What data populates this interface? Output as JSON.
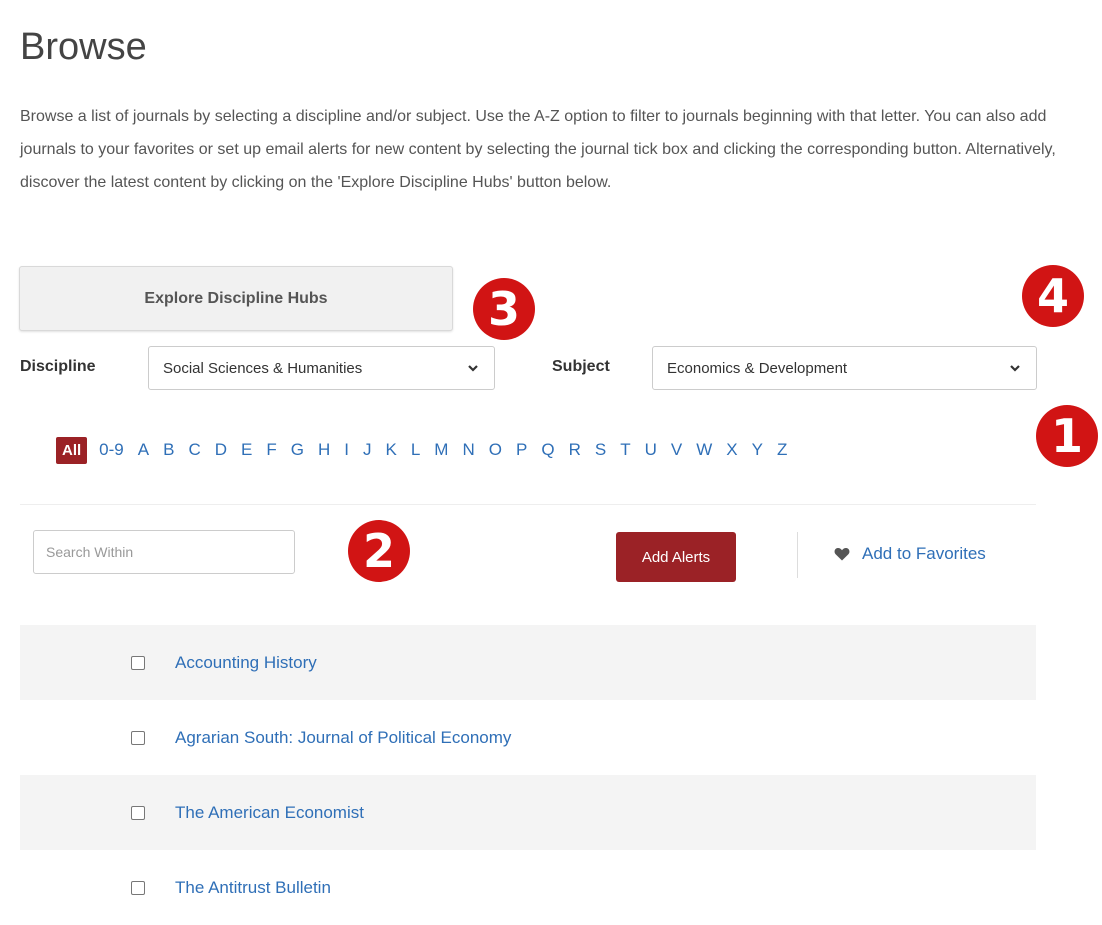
{
  "page": {
    "title": "Browse",
    "intro": "Browse a list of journals by selecting a discipline and/or subject. Use the A-Z option to filter to journals beginning with that letter. You can also add journals to your favorites or set up email alerts for new content by selecting the journal tick box and clicking the corresponding button. Alternatively, discover the latest content by clicking on the 'Explore Discipline Hubs' button below."
  },
  "hubs_button": {
    "label": "Explore Discipline Hubs"
  },
  "filters": {
    "discipline_label": "Discipline",
    "discipline_value": "Social Sciences & Humanities",
    "subject_label": "Subject",
    "subject_value": "Economics & Development"
  },
  "az": {
    "all_label": "All",
    "items": [
      "0-9",
      "A",
      "B",
      "C",
      "D",
      "E",
      "F",
      "G",
      "H",
      "I",
      "J",
      "K",
      "L",
      "M",
      "N",
      "O",
      "P",
      "Q",
      "R",
      "S",
      "T",
      "U",
      "V",
      "W",
      "X",
      "Y",
      "Z"
    ]
  },
  "actions": {
    "search_placeholder": "Search Within",
    "add_alerts_label": "Add Alerts",
    "add_favorites_label": "Add to Favorites"
  },
  "journals": [
    "Accounting History",
    "Agrarian South: Journal of Political Economy",
    "The American Economist",
    "The Antitrust Bulletin"
  ],
  "markers": [
    "1",
    "2",
    "3",
    "4"
  ],
  "colors": {
    "accent": "#9b2226",
    "link": "#2f6fb7",
    "marker": "#d11414",
    "row_shade": "#f4f4f4"
  },
  "icons": {
    "select_arrow": "chevron-down-icon",
    "favorites": "heart-icon"
  }
}
